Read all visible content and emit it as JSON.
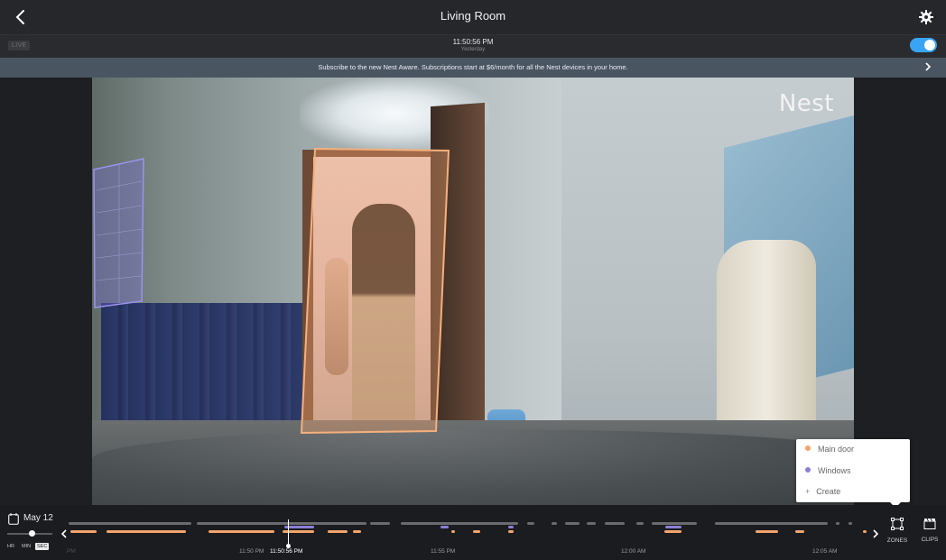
{
  "header": {
    "title": "Living Room",
    "back_icon": "chevron-left-icon",
    "settings_icon": "gear-icon"
  },
  "status": {
    "live_label": "LIVE",
    "time": "11:50:56 PM",
    "day": "Yesterday",
    "camera_on": true,
    "accent": "#3aa4f4"
  },
  "banner": {
    "text": "Subscribe to the new Nest Aware. Subscriptions start at $6/month for all the Nest devices in your home."
  },
  "video": {
    "watermark": "Nest"
  },
  "zones_menu": {
    "items": [
      {
        "label": "Main door",
        "color": "#f4a46b"
      },
      {
        "label": "Windows",
        "color": "#8c7fd6"
      },
      {
        "label": "Create",
        "icon": "plus-icon"
      }
    ]
  },
  "timeline": {
    "date": "May 12",
    "calendar_icon": "calendar-icon",
    "zoom_levels": [
      "HR",
      "MIN",
      "SEC"
    ],
    "zoom_selected": "SEC",
    "ticks": [
      {
        "label": "PM",
        "faded": true
      },
      {
        "label": "11:50 PM",
        "faded": false
      },
      {
        "label": "11:50:56 PM",
        "current": true
      },
      {
        "label": "11:55 PM",
        "faded": false
      },
      {
        "label": "12:00 AM",
        "faded": false
      },
      {
        "label": "12:05 AM",
        "faded": false
      }
    ]
  },
  "tools": {
    "zones_label": "ZONES",
    "clips_label": "CLIPS",
    "zones_icon": "zones-icon",
    "clips_icon": "clapperboard-icon"
  }
}
